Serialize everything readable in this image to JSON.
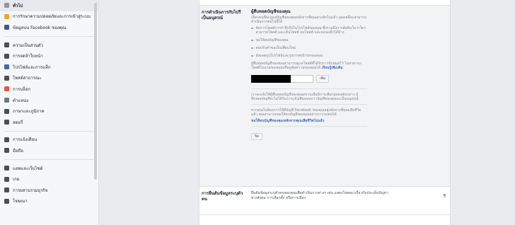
{
  "sidebar": {
    "items": [
      {
        "label": "ทั่วไป",
        "icon": "gear-icon",
        "color": "#90949c",
        "active": true
      },
      {
        "label": "การรักษาความปลอดภัยและการเข้าสู่ระบบ",
        "icon": "shield-icon",
        "color": "#f5a623"
      },
      {
        "label": "ข้อมูลบน Facebook ของคุณ",
        "icon": "facebook-icon",
        "color": "#3b5998"
      },
      {
        "label": "ความเป็นส่วนตัว",
        "icon": "lock-icon",
        "color": "#4b4f56"
      },
      {
        "label": "การจดจำใบหน้า",
        "icon": "face-icon",
        "color": "#4b4f56"
      },
      {
        "label": "โปรไฟล์และการแท็ก",
        "icon": "tag-icon",
        "color": "#4267b2"
      },
      {
        "label": "โพสต์สาธารณะ",
        "icon": "globe-icon",
        "color": "#4b4f56"
      },
      {
        "label": "การบล็อก",
        "icon": "block-icon",
        "color": "#e9573f"
      },
      {
        "label": "ตำแหน่ง",
        "icon": "pin-icon",
        "color": "#6e7788"
      },
      {
        "label": "ภาษาและภูมิภาค",
        "icon": "language-icon",
        "color": "#4b4f56"
      },
      {
        "label": "สตอรี่",
        "icon": "story-icon",
        "color": "#4b4f56"
      },
      {
        "label": "การแจ้งเตือน",
        "icon": "bell-icon",
        "color": "#4b4f56"
      },
      {
        "label": "มือถือ",
        "icon": "mobile-icon",
        "color": "#4b4f56"
      },
      {
        "label": "แอพและเว็บไซต์",
        "icon": "apps-icon",
        "color": "#4b4f56"
      },
      {
        "label": "เกม",
        "icon": "game-icon",
        "color": "#4b4f56"
      },
      {
        "label": "การผสานรวมธุรกิจ",
        "icon": "business-icon",
        "color": "#4b4f56"
      },
      {
        "label": "โฆษณา",
        "icon": "ads-icon",
        "color": "#4b4f56"
      }
    ]
  },
  "main": {
    "row1_label": "การดำเนินการกับไปรีเป็นอนุสรณ์",
    "heading": "ผู้สืบทอดบัญชีของคุณ",
    "intro": "เลือกคนที่จะดูแลบัญชีของคุณหลังจากที่คุณล่วงลับไปแล้ว บุคคลนี้จะสามารถดำเนินการต่อไปนี้ได้",
    "bullets": [
      "จัดการโพสต์การรำลึกถึงในโปรไฟล์ของคุณ ซึ่งรวมถึงการตัดสินใจว่าใครสามารถโพสต์ และเห็นโพสต์ ลบโพสต์ และถอนแท็กได้บ้าง",
      "ขอให้ลบบัญชีของคุณ",
      "ตอบรับคำขอเป็นเพื่อนใหม่",
      "อัพเดตรูปโปรไฟล์และรูปภาพหน้าปกของคุณ"
    ],
    "note": "ผู้สืบทอดบัญชีของคุณสามารถดูแลโพสต์ที่ได้รับการปักหมุดไว้ ไม่สามารถโพสต์ในนามของคุณหรือดูข้อความของคุณได้",
    "learn_more": "เรียนรู้เพิ่มเติม",
    "add_button": "เพิ่ม",
    "notify_text": "เราจะแจ้งให้ผู้สืบทอดบัญชีของคุณทราบเมื่อมีการเลือกบุคคลดังกล่าว ผู้สืบทอดบัญชีจะไม่ได้รับการแจ้งเตือนจนกว่าบัญชีของคุณจะเป็นอนุสรณ์",
    "delete_text": "หากคุณไม่ต้องการให้มีบัญชี Facebook ของคุณอยู่หลังจากที่คุณเสียชีวิตแล้ว คุณสามารถขอให้ลบบัญชีของคุณอย่างถาวรแทนได้",
    "delete_link": "ขอให้ลบบัญชีของคุณหลังจากคุณเสียชีวิตไปแล้ว",
    "close_button": "ปิด",
    "row2_label": "การยืนยันข้อมูลระบุตัวตน",
    "row2_text": "ยืนยันข้อมูลระบุตัวตนของคุณเพื่อดำเนินการต่างๆ เช่น แสดงโฆษณาเกี่ยวกับประเด็นปัญหาทางสังคม การเลือกตั้ง หรือการเมือง",
    "row2_edit": "ดู"
  }
}
